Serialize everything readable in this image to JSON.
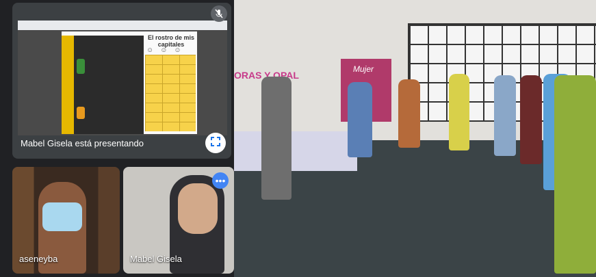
{
  "presentation": {
    "presenter_caption": "Mabel Gisela está presentando",
    "slide_title": "El rostro de mis capitales",
    "mic_icon": "mic-off-icon",
    "fullscreen_icon": "fullscreen-icon",
    "colors": {
      "slide_accent": "#e6b800",
      "grid": "#f7d24a",
      "dark_panel": "#2b2b2b"
    }
  },
  "participants": [
    {
      "name": "aseneyba"
    },
    {
      "name": "Mabel Gisela",
      "menu_icon": "more-options-icon"
    }
  ],
  "room": {
    "wall_text": "ORAS Y OPAL",
    "banner_text": "Mujer"
  }
}
